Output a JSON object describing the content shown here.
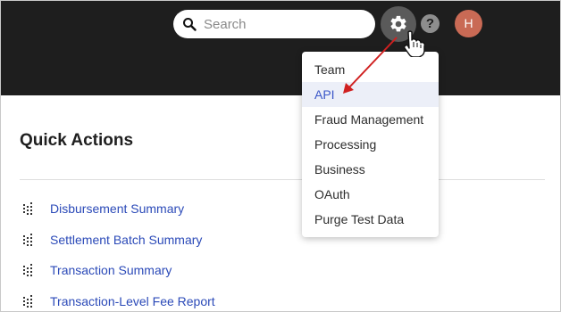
{
  "header": {
    "search": {
      "placeholder": "Search",
      "value": ""
    },
    "help_label": "?",
    "avatar_initial": "H"
  },
  "settings_menu": {
    "items": [
      {
        "label": "Team"
      },
      {
        "label": "API",
        "active": true
      },
      {
        "label": "Fraud Management"
      },
      {
        "label": "Processing"
      },
      {
        "label": "Business"
      },
      {
        "label": "OAuth"
      },
      {
        "label": "Purge Test Data"
      }
    ]
  },
  "quick_actions": {
    "title": "Quick Actions",
    "items": [
      {
        "label": "Disbursement Summary"
      },
      {
        "label": "Settlement Batch Summary"
      },
      {
        "label": "Transaction Summary"
      },
      {
        "label": "Transaction-Level Fee Report"
      }
    ]
  },
  "colors": {
    "topbar": "#1e1e1e",
    "link": "#2b4ab8",
    "menu_active_bg": "#eceff8",
    "menu_active_text": "#3a56c8",
    "avatar": "#c96a55",
    "annotation_arrow": "#d02020"
  },
  "icons": {
    "search": "search-icon",
    "settings": "gear-icon",
    "help": "help-icon",
    "report": "report-icon",
    "pointer": "hand-cursor-icon"
  }
}
